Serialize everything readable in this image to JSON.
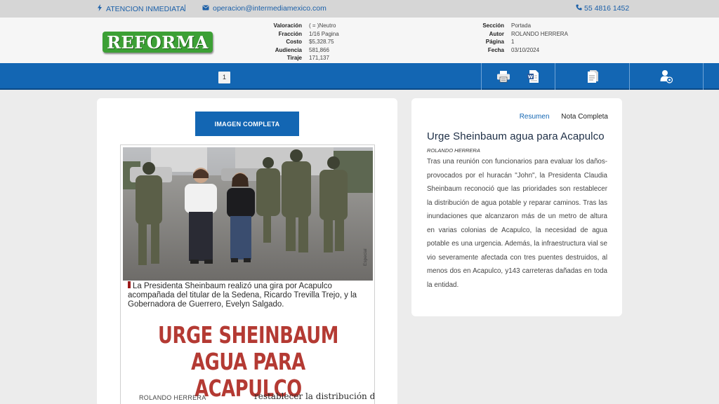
{
  "topbar": {
    "attention_label": "ATENCION INMEDIATA",
    "email": "operacion@intermediamexico.com",
    "phone": "55 4816 1452",
    "separator": "|"
  },
  "header": {
    "logo_text": "REFORMA",
    "meta_left": [
      {
        "key": "Valoración",
        "value": "( = )Neutro"
      },
      {
        "key": "Fracción",
        "value": "1/16 Pagina"
      },
      {
        "key": "Costo",
        "value": "$5,328.75"
      },
      {
        "key": "Audiencia",
        "value": "581,866"
      },
      {
        "key": "Tiraje",
        "value": "171,137"
      }
    ],
    "meta_right": [
      {
        "key": "Sección",
        "value": "Portada"
      },
      {
        "key": "Autor",
        "value": "ROLANDO HERRERA"
      },
      {
        "key": "Página",
        "value": "1"
      },
      {
        "key": "Fecha",
        "value": "03/10/2024"
      }
    ]
  },
  "nav": {
    "page_number": "1",
    "tools": [
      "print-icon",
      "word-icon",
      "document-icon",
      "user-settings-icon"
    ]
  },
  "clip": {
    "button_label": "IMAGEN COMPLETA",
    "caption": "La Presidenta Sheinbaum realizó una gira por Acapulco acompañada del titular de la Sedena, Ricardo Trevilla Trejo, y la Gobernadora de Guerrero, Evelyn Salgado.",
    "photo_credit": "Especial",
    "headline_line1": "URGE SHEINBAUM",
    "headline_line2": "AGUA PARA ACAPULCO",
    "byline": "ROLANDO HERRERA",
    "snippet": "restablecer la distribución del"
  },
  "article": {
    "tab_summary": "Resumen",
    "tab_full": "Nota Completa",
    "title": "Urge Sheinbaum agua para Acapulco",
    "author": "ROLANDO HERRERA",
    "body": "Tras una reunión con funcionarios para evaluar los daños-provocados por el huracán \"John\", la Presidenta Claudia Sheinbaum reconoció que las prioridades son restablecer la distribución de agua potable y reparar caminos. Tras las inundaciones que alcanzaron más de un metro de altura en varias colonias de Acapulco, la necesidad de agua potable es una urgencia. Además, la infraestructura vial se vio severamente afectada con tres puentes destruidos, al menos dos en Acapulco, y143 carreteras dañadas en toda la entidad."
  },
  "colors": {
    "brand_blue": "#1366b3",
    "logo_green": "#3ca035",
    "headline_red": "#b43a33"
  }
}
